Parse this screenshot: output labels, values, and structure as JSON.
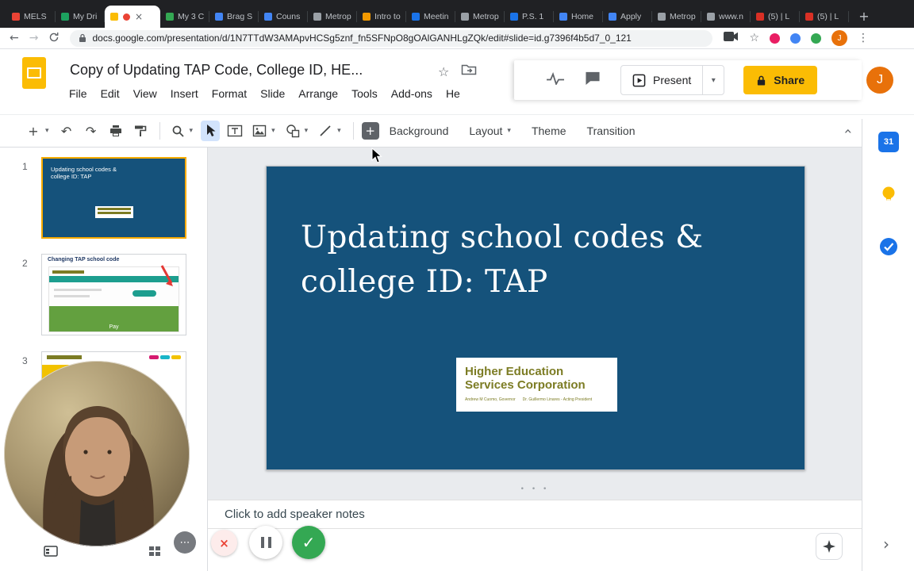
{
  "browser": {
    "tabs": [
      {
        "title": "MELS",
        "color": "#ea4335"
      },
      {
        "title": "My Dri",
        "color": "#1da15f"
      },
      {
        "title": "",
        "color": "#fbbc04"
      },
      {
        "title": "My 3 C",
        "color": "#34a853"
      },
      {
        "title": "Brag S",
        "color": "#4285f4"
      },
      {
        "title": "Couns",
        "color": "#4285f4"
      },
      {
        "title": "Metrop",
        "color": "#9aa0a6"
      },
      {
        "title": "Intro to",
        "color": "#f29900"
      },
      {
        "title": "Meetin",
        "color": "#1a73e8"
      },
      {
        "title": "Metrop",
        "color": "#9aa0a6"
      },
      {
        "title": "P.S. 1",
        "color": "#1a73e8"
      },
      {
        "title": "Home",
        "color": "#4285f4"
      },
      {
        "title": "Apply",
        "color": "#4285f4"
      },
      {
        "title": "Metrop",
        "color": "#9aa0a6"
      },
      {
        "title": "www.n",
        "color": "#9aa0a6"
      },
      {
        "title": "(5) | L",
        "color": "#d93025"
      },
      {
        "title": "(5) | L",
        "color": "#d93025"
      }
    ],
    "url": "docs.google.com/presentation/d/1N7TTdW3AMApvHCSg5znf_fn5SFNpO8gOAlGANHLgZQk/edit#slide=id.g7396f4b5d7_0_121",
    "profile_initial": "J"
  },
  "header": {
    "doc_title": "Copy of Updating TAP Code, College ID, HE...",
    "menus": [
      "File",
      "Edit",
      "View",
      "Insert",
      "Format",
      "Slide",
      "Arrange",
      "Tools",
      "Add-ons",
      "He"
    ],
    "present_label": "Present",
    "share_label": "Share",
    "avatar_initial": "J"
  },
  "toolbar": {
    "background_label": "Background",
    "layout_label": "Layout",
    "theme_label": "Theme",
    "transition_label": "Transition"
  },
  "filmstrip": {
    "slide1": {
      "num": "1",
      "line1": "Updating school codes &",
      "line2": "college ID: TAP"
    },
    "slide2": {
      "num": "2",
      "title": "Changing TAP school code",
      "pay": "Pay"
    },
    "slide3": {
      "num": "3"
    }
  },
  "slide": {
    "bg_color": "#15527b",
    "title_line1": "Updating school codes &",
    "title_line2": "college ID: TAP",
    "logo_line1": "Higher Education",
    "logo_line2": "Services Corporation",
    "logo_sub1": "Andrew M Cuomo, Governor",
    "logo_sub2": "Dr. Guillermo Linares - Acting President"
  },
  "notes": {
    "placeholder": "Click to add speaker notes"
  },
  "sidebar": {
    "calendar_label": "31"
  },
  "icons": {
    "back": "←",
    "forward": "→",
    "close": "×",
    "kebab": "⋮",
    "star": "☆",
    "caret": "▾",
    "plus": "+",
    "undo": "↶",
    "redo": "↷",
    "check": "✓",
    "chevron": "›",
    "more": "⋯",
    "grip": "• • •"
  },
  "colors": {
    "share_bg": "#fbbc04",
    "check_green": "#34a853",
    "record_red": "#ea4335",
    "avatar_orange": "#e8710a"
  }
}
